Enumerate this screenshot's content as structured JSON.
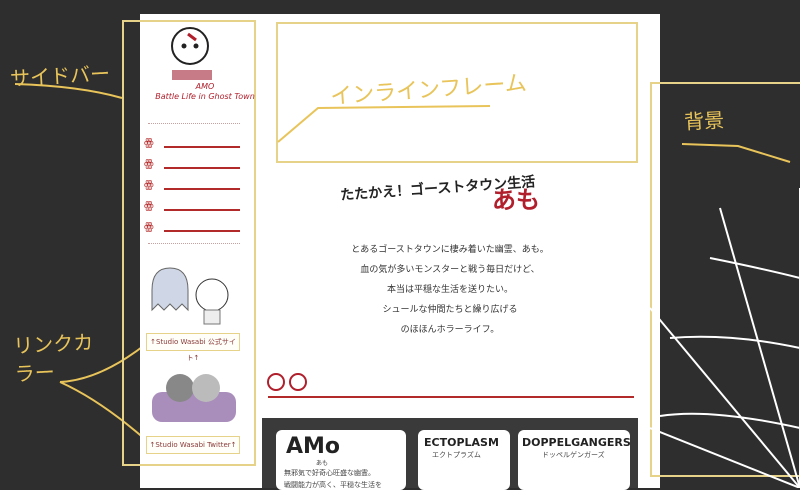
{
  "annotations": {
    "sidebar": "サイドバー",
    "link_color": "リンクカラー",
    "background": "背景",
    "inline_frame": "インラインフレーム"
  },
  "sidebar": {
    "logo_title": "AMO",
    "logo_subtitle": "Battle Life in Ghost Town",
    "links": [
      "↑Studio Wasabi 公式サイト↑",
      "↑Studio Wasabi Twitter↑"
    ]
  },
  "main": {
    "title_text": "たたかえ！ゴーストタウン生活",
    "title_amo": "あも",
    "intro_lines": [
      "とあるゴーストタウンに棲み着いた幽霊、あも。",
      "血の気が多いモンスターと戦う毎日だけど、",
      "本当は平穏な生活を送りたい。",
      "シュールな仲間たちと繰り広げる",
      "のほほんホラーライフ。"
    ]
  },
  "cards": [
    {
      "title": "AMo",
      "ruby": "あも",
      "desc_1": "無邪気で好奇心旺盛な幽霊。",
      "desc_2": "戦闘能力が高く、平穏な生活を"
    },
    {
      "title": "ECTOPLASM",
      "ruby": "エクトプラズム"
    },
    {
      "title": "DOPPELGANGERS",
      "ruby": "ドッペルゲンガーズ"
    }
  ],
  "colors": {
    "background": "#2e2e2e",
    "accent": "#e8c45a",
    "brand_red": "#b01f2b",
    "frame": "#e7d28a"
  }
}
